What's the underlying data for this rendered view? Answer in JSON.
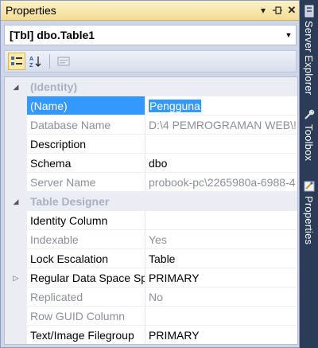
{
  "titlebar": {
    "title": "Properties"
  },
  "object_selector": {
    "value": "[Tbl] dbo.Table1"
  },
  "groups": [
    {
      "label": "(Identity)",
      "rows": [
        {
          "name": "(Name)",
          "value": "Pengguna"
        },
        {
          "name": "Database Name",
          "value": "D:\\4 PEMROGRAMAN WEB\\!"
        },
        {
          "name": "Description",
          "value": ""
        },
        {
          "name": "Schema",
          "value": "dbo"
        },
        {
          "name": "Server Name",
          "value": "probook-pc\\2265980a-6988-4"
        }
      ]
    },
    {
      "label": "Table Designer",
      "rows": [
        {
          "name": "Identity Column",
          "value": ""
        },
        {
          "name": "Indexable",
          "value": "Yes"
        },
        {
          "name": "Lock Escalation",
          "value": "Table"
        },
        {
          "name": "Regular Data Space Sp",
          "value": "PRIMARY"
        },
        {
          "name": "Replicated",
          "value": "No"
        },
        {
          "name": "Row GUID Column",
          "value": ""
        },
        {
          "name": "Text/Image Filegroup",
          "value": "PRIMARY"
        }
      ]
    }
  ],
  "side_tabs": {
    "server_explorer": "Server Explorer",
    "toolbox": "Toolbox",
    "properties": "Properties"
  },
  "colors": {
    "selection": "#3399ff",
    "titlebar": "#f4dc92",
    "sidebar": "#2b3c59"
  }
}
